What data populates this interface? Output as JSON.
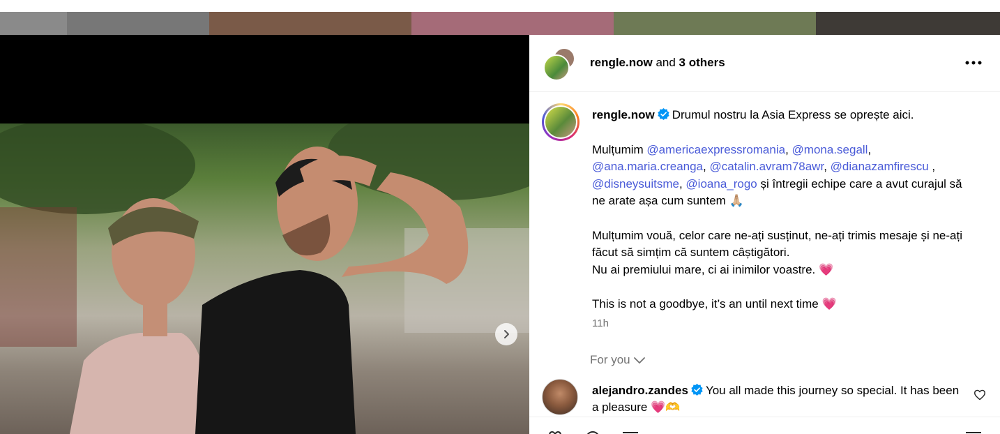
{
  "header": {
    "username": "rengle.now",
    "and_text": " and ",
    "others": "3 others"
  },
  "caption": {
    "username": "rengle.now",
    "line1": "Drumul nostru la Asia Express se oprește aici.",
    "thanks_prefix": "Mulțumim ",
    "mentions": [
      "@americaexpressromania",
      "@mona.segall",
      "@ana.maria.creanga",
      "@catalin.avram78awr",
      "@dianazamfirescu",
      "@disneysuitsme",
      "@ioana_rogo"
    ],
    "sep_comma": ", ",
    "sep_comma_space": " , ",
    "thanks_suffix": " și întregii echipe care a avut curajul să ne arate așa cum suntem 🙏🏼",
    "para2_line1": "Mulțumim vouă, celor care ne-ați susținut, ne-ați trimis mesaje și ne-ați făcut să simțim că suntem câștigători.",
    "para2_line2": "Nu ai premiului mare, ci ai inimilor voastre. 💗",
    "para3": "This is not a goodbye, it’s an until next time 💗",
    "time": "11h"
  },
  "for_you": "For you",
  "comment": {
    "username": "alejandro.zandes",
    "text": "You all made this journey so special. It has been a pleasure 💗🫶"
  },
  "icons": {
    "next": "chevron-right-icon",
    "more": "more-horizontal-icon",
    "verified": "verified-badge-icon",
    "like": "heart-icon"
  },
  "colors": {
    "mention": "#4a5bd8",
    "verified": "#0095f6",
    "muted": "#737373"
  }
}
